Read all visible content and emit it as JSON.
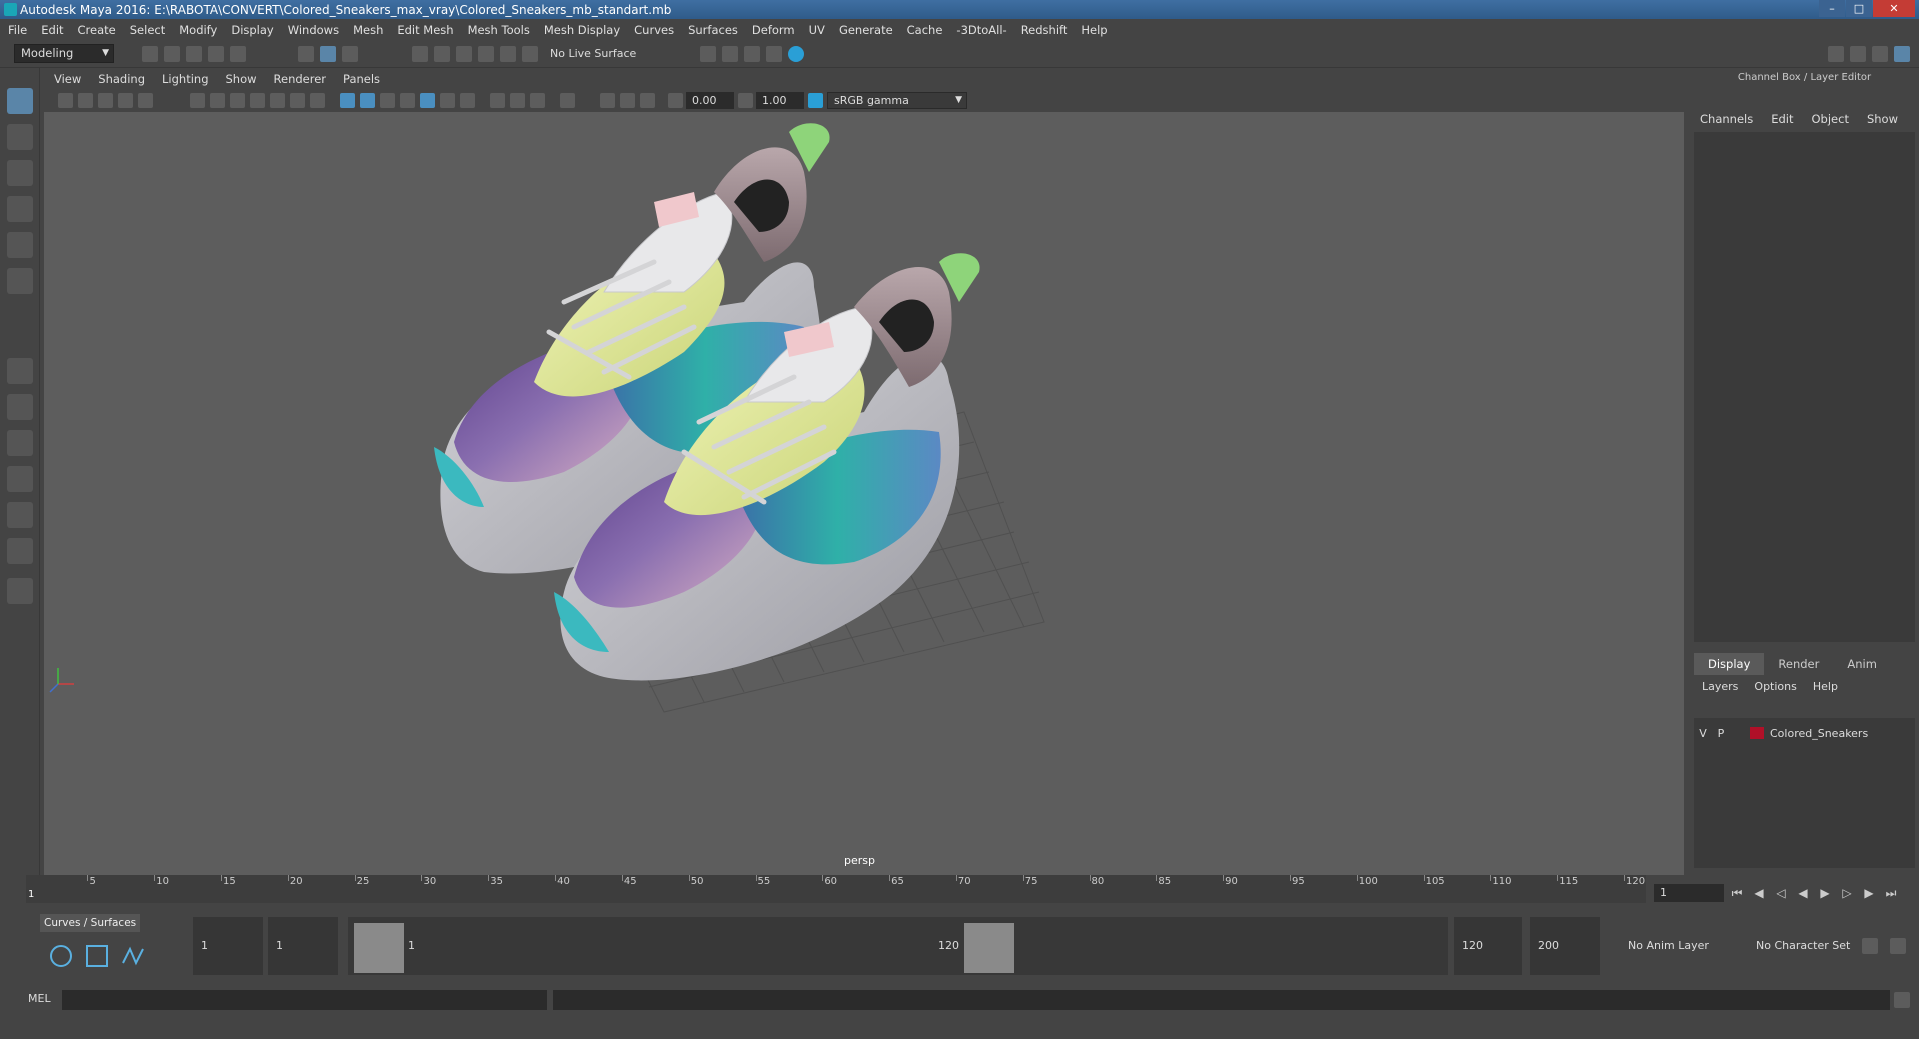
{
  "window": {
    "title": "Autodesk Maya 2016: E:\\RABOTA\\CONVERT\\Colored_Sneakers_max_vray\\Colored_Sneakers_mb_standart.mb"
  },
  "menubar": [
    "File",
    "Edit",
    "Create",
    "Select",
    "Modify",
    "Display",
    "Windows",
    "Mesh",
    "Edit Mesh",
    "Mesh Tools",
    "Mesh Display",
    "Curves",
    "Surfaces",
    "Deform",
    "UV",
    "Generate",
    "Cache",
    "-3DtoAll-",
    "Redshift",
    "Help"
  ],
  "toolbar": {
    "mode": "Modeling",
    "live_surface": "No Live Surface"
  },
  "viewport": {
    "menu": [
      "View",
      "Shading",
      "Lighting",
      "Show",
      "Renderer",
      "Panels"
    ],
    "exposure": "0.00",
    "gamma": "1.00",
    "colorspace": "sRGB gamma",
    "camera": "persp"
  },
  "channel_box": {
    "title": "Channel Box / Layer Editor",
    "menu": [
      "Channels",
      "Edit",
      "Object",
      "Show"
    ]
  },
  "layer_editor": {
    "tabs": [
      "Display",
      "Render",
      "Anim"
    ],
    "menu": [
      "Layers",
      "Options",
      "Help"
    ],
    "layers": [
      {
        "v": "V",
        "p": "P",
        "name": "Colored_Sneakers",
        "color": "#b01028"
      }
    ]
  },
  "timeline": {
    "start": "1",
    "current_frame": "1",
    "ticks": [
      "5",
      "10",
      "15",
      "20",
      "25",
      "30",
      "35",
      "40",
      "45",
      "50",
      "55",
      "60",
      "65",
      "70",
      "75",
      "80",
      "85",
      "90",
      "95",
      "100",
      "105",
      "110",
      "115",
      "120"
    ]
  },
  "shelf": {
    "tab": "Curves / Surfaces"
  },
  "range": {
    "start": "1",
    "playback_start": "1",
    "range_start_label": "1",
    "range_end_label": "120",
    "playback_end": "120",
    "end": "200",
    "anim_layer": "No Anim Layer",
    "character_set": "No Character Set"
  },
  "command": {
    "language": "MEL"
  }
}
